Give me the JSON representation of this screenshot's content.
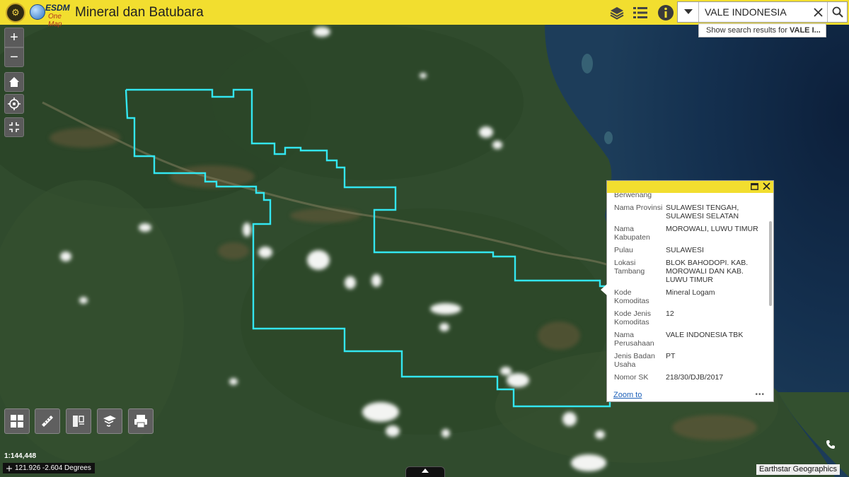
{
  "app": {
    "title": "Mineral dan Batubara",
    "logo_text_top": "ESDM",
    "logo_text_bottom": "One Map"
  },
  "search": {
    "value": "VALE INDONESIA",
    "suggestion_prefix": "Show search results for ",
    "suggestion_query": "VALE I..."
  },
  "map": {
    "scale_text": "1:144,448",
    "coordinates": "121.926 -2.604 Degrees",
    "attribution": "Earthstar Geographics",
    "boundary_color": "#33e6f0"
  },
  "popup": {
    "partial_top_label": "Berwenang",
    "fields": [
      {
        "label": "Nama Provinsi",
        "value": "SULAWESI TENGAH, SULAWESI SELATAN"
      },
      {
        "label": "Nama Kabupaten",
        "value": "MOROWALI, LUWU TIMUR"
      },
      {
        "label": "Pulau",
        "value": "SULAWESI"
      },
      {
        "label": "Lokasi Tambang",
        "value": "BLOK BAHODOPI. KAB. MOROWALI DAN KAB. LUWU TIMUR"
      },
      {
        "label": "Kode Komoditas",
        "value": "Mineral Logam"
      },
      {
        "label": "Kode Jenis Komoditas",
        "value": "12"
      },
      {
        "label": "Nama Perusahaan",
        "value": "VALE INDONESIA TBK"
      },
      {
        "label": "Jenis Badan Usaha",
        "value": "PT"
      },
      {
        "label": "Nomor SK",
        "value": "218/30/DJB/2017"
      }
    ],
    "zoom_to": "Zoom to",
    "more": "•••"
  },
  "icons": {
    "zoom_in": "+",
    "zoom_out": "−"
  }
}
